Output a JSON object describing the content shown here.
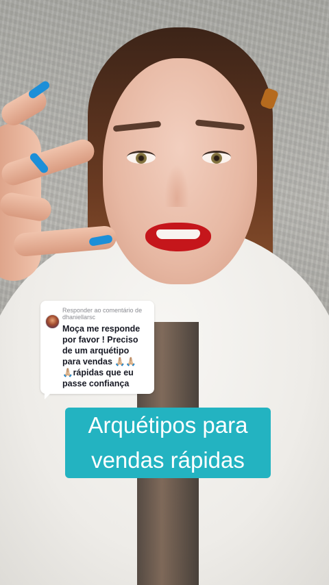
{
  "reply": {
    "header_line1": "Responder ao comentário de",
    "header_line2": "dhaniellarsc",
    "body_lines": [
      "Moça me responde",
      "por favor ! Preciso",
      "de um arquétipo",
      "para vendas 🙏🏼🙏🏼",
      "🙏🏼rápidas que eu",
      "passe confiança"
    ]
  },
  "caption": {
    "line1": "Arquétipos para",
    "line2": "vendas rápidas"
  },
  "colors": {
    "caption_background": "#23b3c1",
    "caption_text": "#ffffff",
    "reply_card_background": "#ffffff",
    "reply_header_text": "#8a8b91",
    "reply_body_text": "#161823",
    "nail_polish": "#1c8fd8",
    "lipstick": "#c5161b"
  }
}
